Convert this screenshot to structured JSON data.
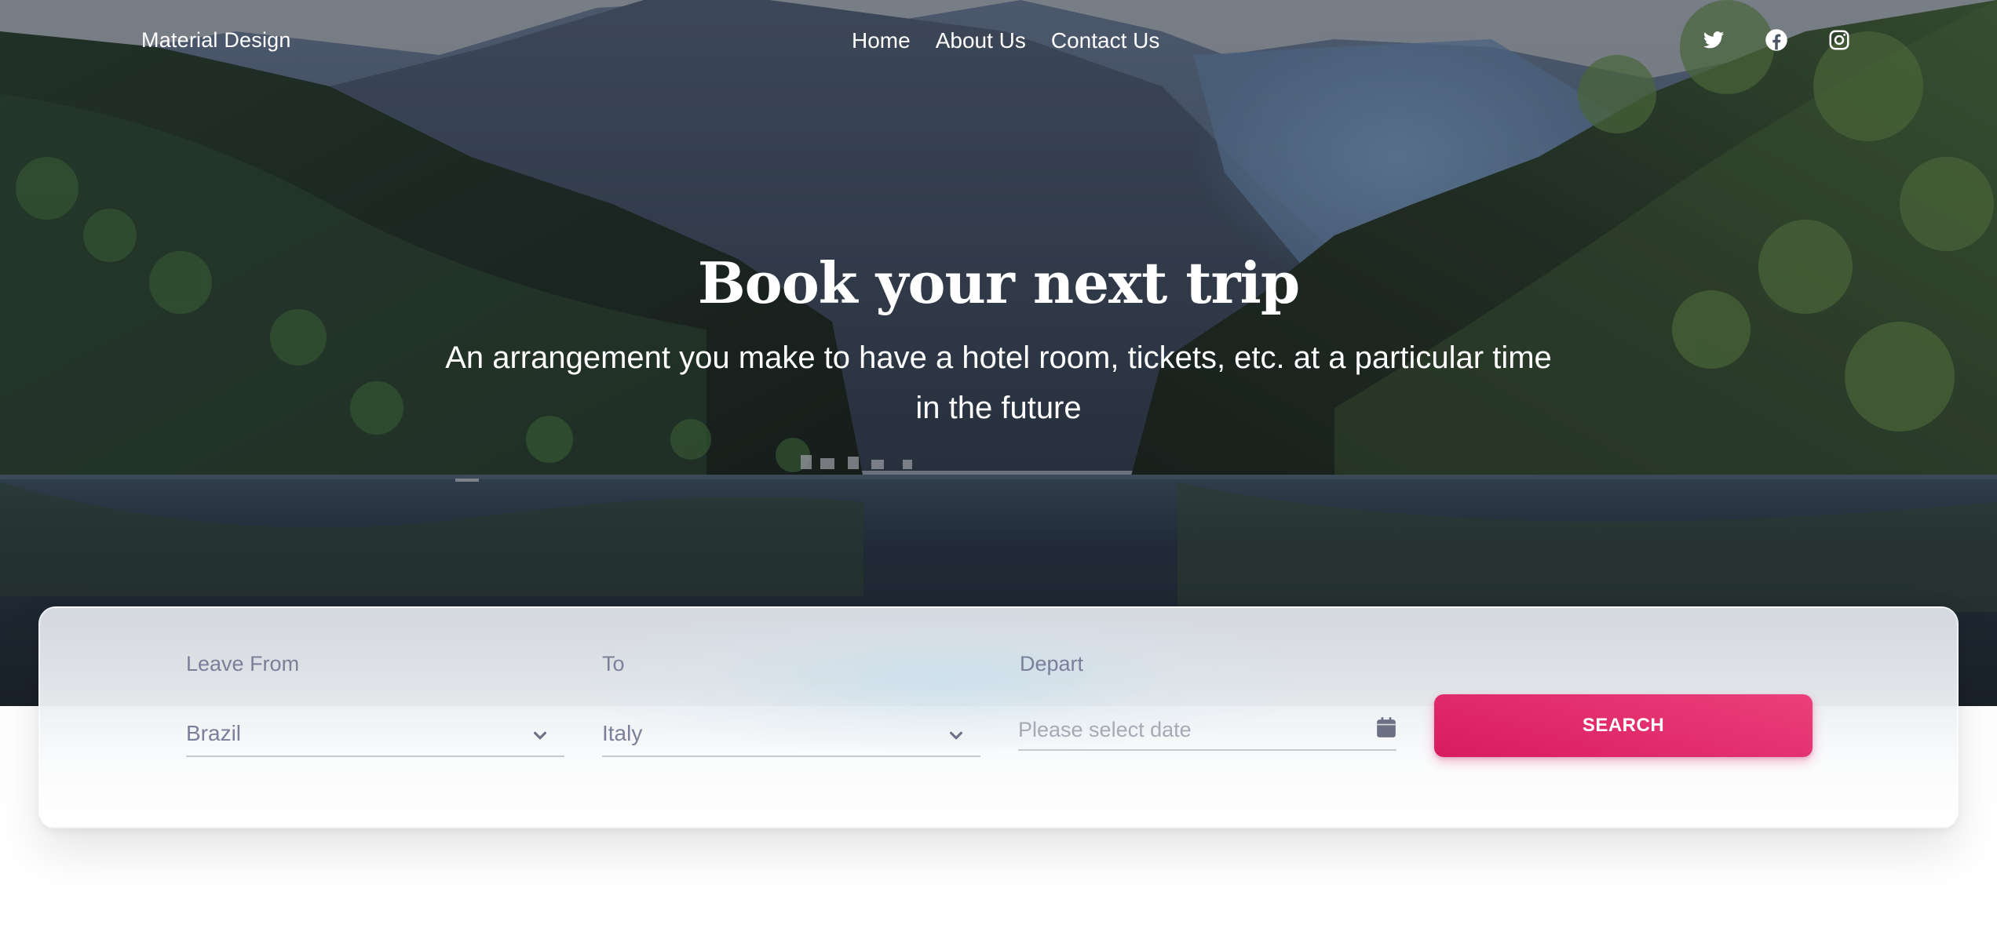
{
  "navbar": {
    "brand": "Material Design",
    "links": [
      {
        "label": "Home"
      },
      {
        "label": "About Us"
      },
      {
        "label": "Contact Us"
      }
    ],
    "socials": [
      "twitter-icon",
      "facebook-icon",
      "instagram-icon"
    ]
  },
  "hero": {
    "title": "Book your next trip",
    "subtitle": "An arrangement you make to have a hotel room, tickets, etc. at a particular time in the future"
  },
  "search": {
    "leave_from": {
      "label": "Leave From",
      "value": "Brazil"
    },
    "to": {
      "label": "To",
      "value": "Italy"
    },
    "depart": {
      "label": "Depart",
      "placeholder": "Please select date",
      "value": ""
    },
    "button_label": "SEARCH"
  },
  "colors": {
    "accent": "#e91e63",
    "label_gray": "#7b809a",
    "text_white": "#ffffff"
  }
}
